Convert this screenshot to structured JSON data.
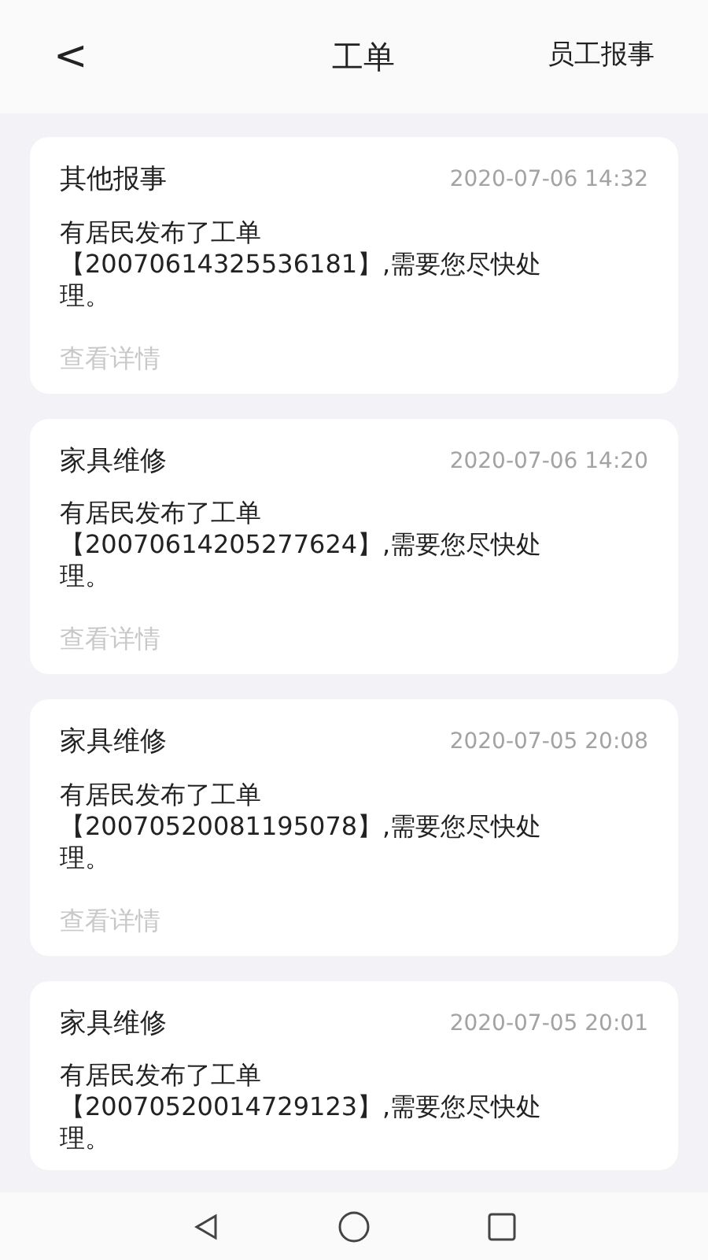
{
  "header": {
    "back": "<",
    "title": "工单",
    "action": "员工报事"
  },
  "cards": [
    {
      "category": "其他报事",
      "time": "2020-07-06 14:32",
      "lines": [
        "有居民发布了工单",
        "【20070614325536181】,需要您尽快处",
        "理。"
      ],
      "detail_link": "查看详情"
    },
    {
      "category": "家具维修",
      "time": "2020-07-06 14:20",
      "lines": [
        "有居民发布了工单",
        "【20070614205277624】,需要您尽快处",
        "理。"
      ],
      "detail_link": "查看详情"
    },
    {
      "category": "家具维修",
      "time": "2020-07-05 20:08",
      "lines": [
        "有居民发布了工单",
        "【20070520081195078】,需要您尽快处",
        "理。"
      ],
      "detail_link": "查看详情"
    },
    {
      "category": "家具维修",
      "time": "2020-07-05 20:01",
      "lines": [
        "有居民发布了工单",
        "【20070520014729123】,需要您尽快处",
        "理。"
      ]
    }
  ]
}
